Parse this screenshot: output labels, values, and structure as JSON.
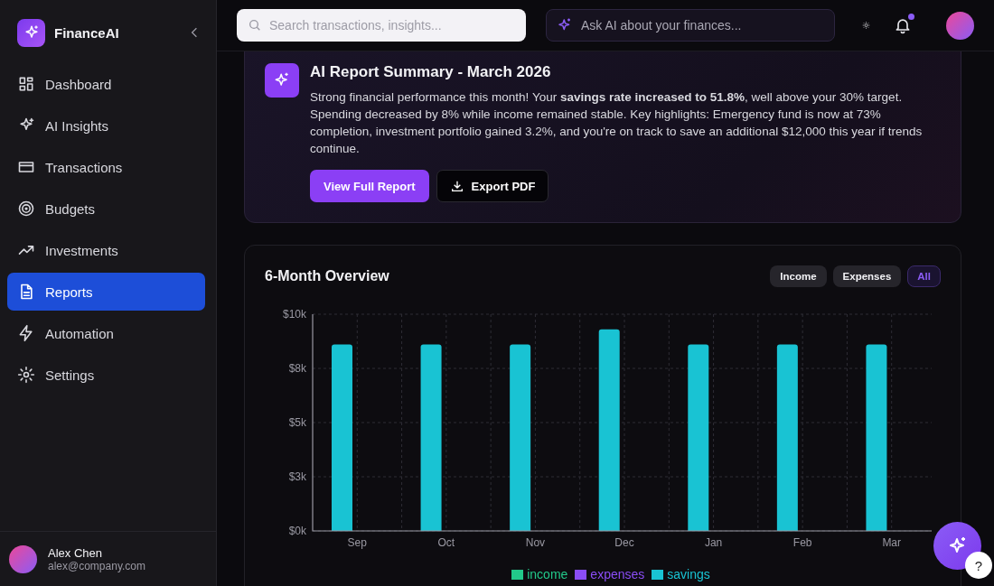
{
  "brand": {
    "name": "FinanceAI"
  },
  "nav": [
    {
      "label": "Dashboard",
      "selected": false
    },
    {
      "label": "AI Insights",
      "selected": false
    },
    {
      "label": "Transactions",
      "selected": false
    },
    {
      "label": "Budgets",
      "selected": false
    },
    {
      "label": "Investments",
      "selected": false
    },
    {
      "label": "Reports",
      "selected": true
    },
    {
      "label": "Automation",
      "selected": false
    },
    {
      "label": "Settings",
      "selected": false
    }
  ],
  "user": {
    "name": "Alex Chen",
    "email": "alex@company.com"
  },
  "search": {
    "placeholder": "Search transactions, insights..."
  },
  "ask_ai": {
    "placeholder": "Ask AI about your finances..."
  },
  "notifications": {
    "unread": true
  },
  "summary": {
    "title": "AI Report Summary - March 2026",
    "text": "Strong financial performance this month! Your **savings rate increased to 51.8%**, well above your 30% target. Spending decreased by 8% while income remained stable. Key highlights: Emergency fund is now at 73% completion, investment portfolio gained 3.2%, and you're on track to save an additional $12,000 this year if trends continue.",
    "buttons": [
      {
        "label": "View Full Report",
        "kind": "primary"
      },
      {
        "label": "Export PDF",
        "kind": "download"
      }
    ]
  },
  "overview": {
    "title": "6-Month Overview",
    "filters": [
      {
        "label": "Income",
        "selected": false
      },
      {
        "label": "Expenses",
        "selected": false
      },
      {
        "label": "All",
        "selected": true
      }
    ],
    "chart_data": {
      "type": "bar",
      "grid": true,
      "categories": [
        "Sep",
        "Oct",
        "Nov",
        "Dec",
        "Jan",
        "Feb",
        "Mar"
      ],
      "series": [
        {
          "name": "income",
          "color": "#22c98a",
          "values": [
            null,
            null,
            null,
            null,
            null,
            null,
            null
          ]
        },
        {
          "name": "expenses",
          "color": "#8a4df5",
          "values": [
            null,
            null,
            null,
            null,
            null,
            null,
            null
          ]
        },
        {
          "name": "savings",
          "color": "#19c3d3",
          "values": [
            8600,
            8600,
            8600,
            9300,
            8600,
            8600,
            8600
          ]
        }
      ],
      "ylim": [
        0,
        10000
      ],
      "yticks": [
        {
          "value": 0,
          "label": "$0k"
        },
        {
          "value": 2500,
          "label": "$3k"
        },
        {
          "value": 5000,
          "label": "$5k"
        },
        {
          "value": 7500,
          "label": "$8k"
        },
        {
          "value": 10000,
          "label": "$10k"
        }
      ]
    }
  },
  "help": {
    "label": "?"
  }
}
